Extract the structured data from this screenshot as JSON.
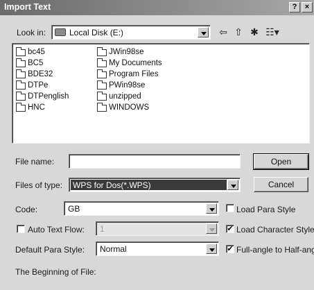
{
  "dialog": {
    "title": "Import Text",
    "help_glyph": "?",
    "close_glyph": "×"
  },
  "look_in": {
    "label": "Look in:",
    "value": "Local Disk (E:)"
  },
  "toolbar": {
    "back_glyph": "⇦",
    "up_glyph": "⇧",
    "newfolder_glyph": "✱",
    "view_glyph": "☷▾"
  },
  "files": {
    "col1": [
      "bc45",
      "BC5",
      "BDE32",
      "DTPe",
      "DTPenglish",
      "HNC"
    ],
    "col2": [
      "JWin98se",
      "My Documents",
      "Program Files",
      "PWin98se",
      "unzipped",
      "WINDOWS"
    ]
  },
  "file_name": {
    "label": "File name:",
    "value": ""
  },
  "file_type": {
    "label": "Files of type:",
    "value": "WPS for Dos(*.WPS)"
  },
  "buttons": {
    "open": "Open",
    "cancel": "Cancel"
  },
  "code": {
    "label": "Code:",
    "value": "GB"
  },
  "auto_text_flow": {
    "label": "Auto Text Flow:",
    "checked": false,
    "value": "1"
  },
  "default_para_style": {
    "label": "Default Para Style:",
    "value": "Normal"
  },
  "options": {
    "load_para_style": {
      "label": "Load Para Style",
      "checked": false
    },
    "load_character_style": {
      "label": "Load Character Style",
      "checked": true
    },
    "full_angle": {
      "label": "Full-angle to Half-angle",
      "checked": true
    }
  },
  "preview": {
    "label": "The Beginning of File:"
  },
  "check_glyph": "✔"
}
